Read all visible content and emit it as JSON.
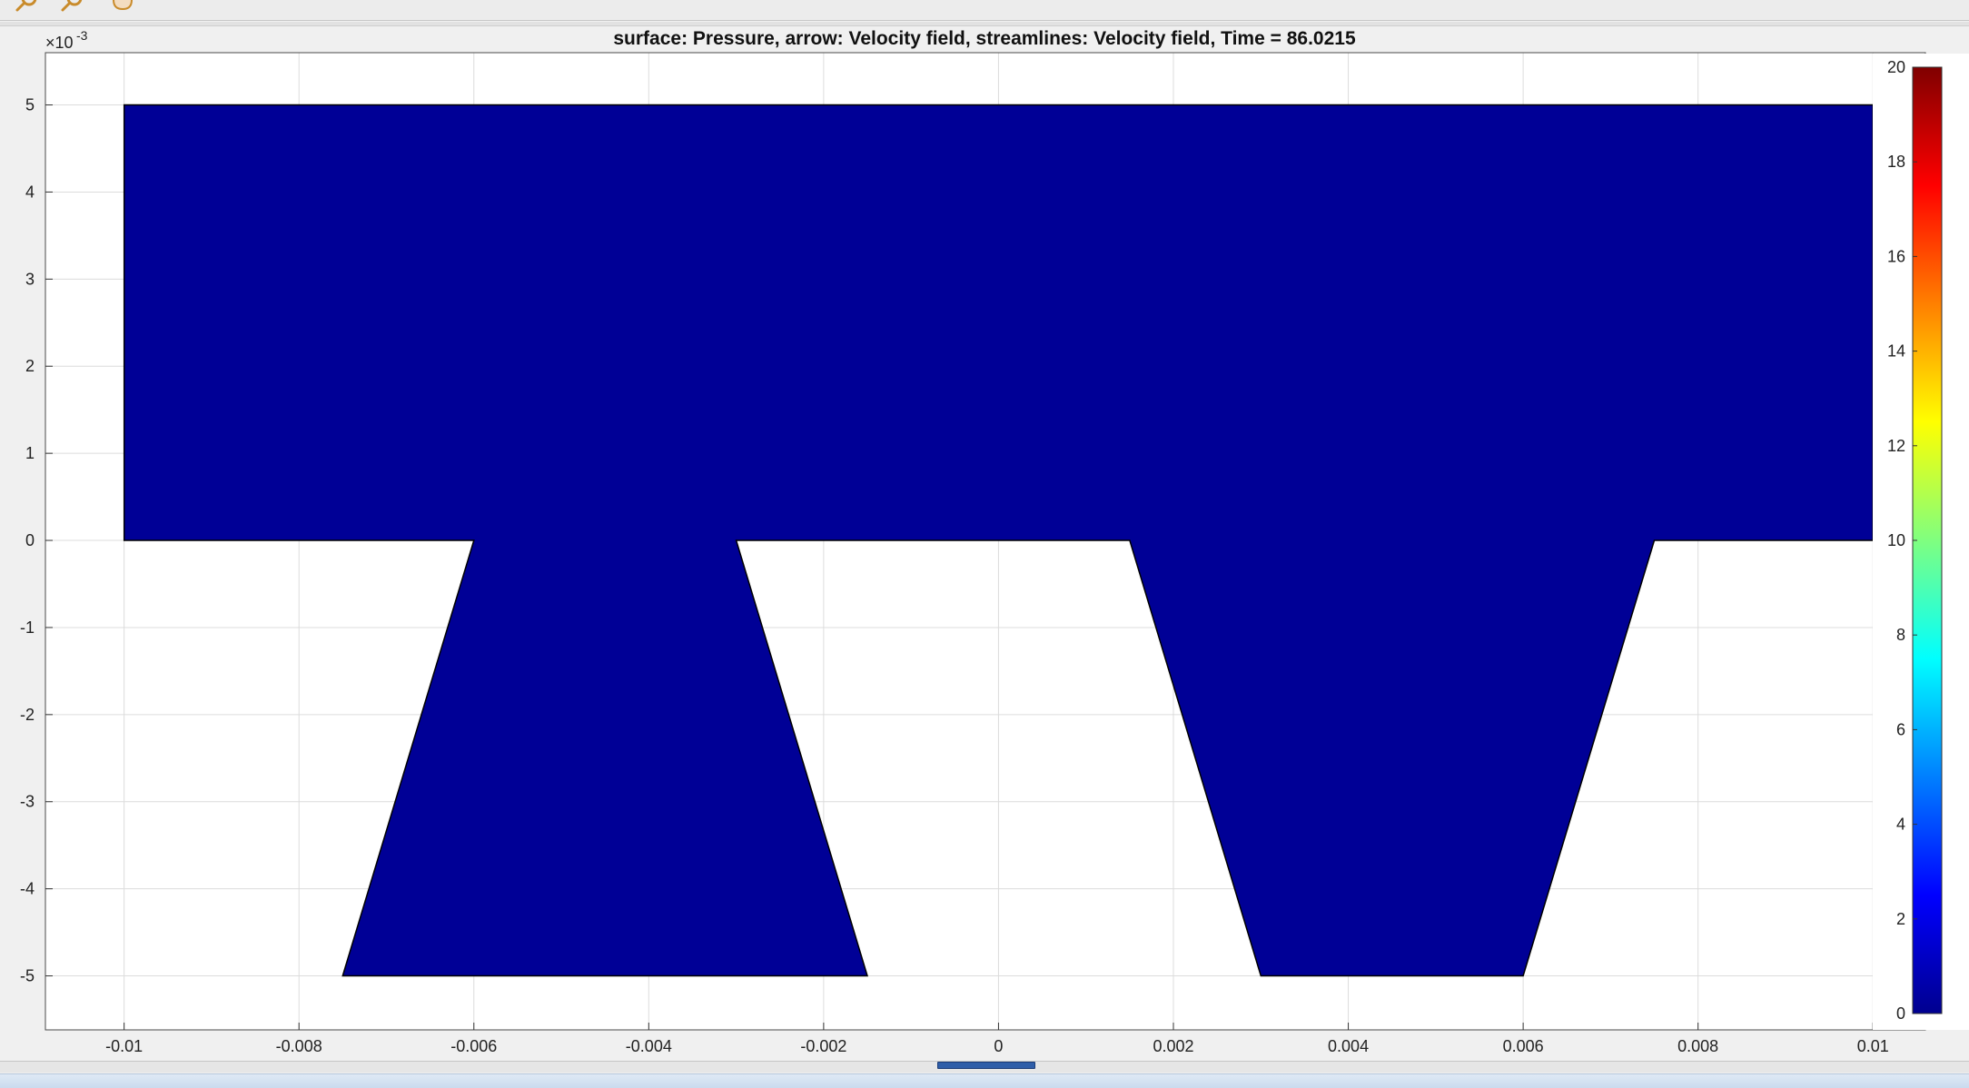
{
  "toolbar": {
    "buttons": [
      {
        "name": "zoom-in-icon"
      },
      {
        "name": "zoom-out-icon"
      },
      {
        "name": "pan-hand-icon"
      }
    ]
  },
  "colors": {
    "domain_fill": "#000096",
    "grid": "#dcdcdc",
    "axes_bg": "#ffffff",
    "figure_bg": "#f0f0f0"
  },
  "chart_data": {
    "type": "heatmap",
    "title": "surface: Pressure, arrow: Velocity field, streamlines: Velocity field, Time = 86.0215",
    "xlabel": "",
    "ylabel": "",
    "xlim": [
      -0.0109,
      0.0106
    ],
    "ylim": [
      -0.00562,
      0.0056
    ],
    "y_exponent_label": "×10",
    "y_exponent_power": "-3",
    "x_ticks": [
      {
        "value": -0.01,
        "label": "-0.01"
      },
      {
        "value": -0.008,
        "label": "-0.008"
      },
      {
        "value": -0.006,
        "label": "-0.006"
      },
      {
        "value": -0.004,
        "label": "-0.004"
      },
      {
        "value": -0.002,
        "label": "-0.002"
      },
      {
        "value": 0,
        "label": "0"
      },
      {
        "value": 0.002,
        "label": "0.002"
      },
      {
        "value": 0.004,
        "label": "0.004"
      },
      {
        "value": 0.006,
        "label": "0.006"
      },
      {
        "value": 0.008,
        "label": "0.008"
      },
      {
        "value": 0.01,
        "label": "0.01"
      }
    ],
    "y_ticks": [
      {
        "value": 0.005,
        "label": "5"
      },
      {
        "value": 0.004,
        "label": "4"
      },
      {
        "value": 0.003,
        "label": "3"
      },
      {
        "value": 0.002,
        "label": "2"
      },
      {
        "value": 0.001,
        "label": "1"
      },
      {
        "value": 0,
        "label": "0"
      },
      {
        "value": -0.001,
        "label": "-1"
      },
      {
        "value": -0.002,
        "label": "-2"
      },
      {
        "value": -0.003,
        "label": "-3"
      },
      {
        "value": -0.004,
        "label": "-4"
      },
      {
        "value": -0.005,
        "label": "-5"
      }
    ],
    "grid": true,
    "domain_outline": [
      [
        -0.01,
        0.005
      ],
      [
        0.01,
        0.005
      ],
      [
        0.01,
        0
      ],
      [
        0.0075,
        0
      ],
      [
        0.006,
        -0.005
      ],
      [
        0.003,
        -0.005
      ],
      [
        0.0015,
        0
      ],
      [
        -0.003,
        0
      ],
      [
        -0.0015,
        -0.005
      ],
      [
        -0.0075,
        -0.005
      ],
      [
        -0.006,
        0
      ],
      [
        -0.01,
        0
      ]
    ],
    "surface_value": 0,
    "colorbar": {
      "min": 0,
      "max": 20,
      "ticks": [
        {
          "value": 0,
          "label": "0"
        },
        {
          "value": 2,
          "label": "2"
        },
        {
          "value": 4,
          "label": "4"
        },
        {
          "value": 6,
          "label": "6"
        },
        {
          "value": 8,
          "label": "8"
        },
        {
          "value": 10,
          "label": "10"
        },
        {
          "value": 12,
          "label": "12"
        },
        {
          "value": 14,
          "label": "14"
        },
        {
          "value": 16,
          "label": "16"
        },
        {
          "value": 18,
          "label": "18"
        },
        {
          "value": 20,
          "label": "20"
        }
      ],
      "colormap": "jet"
    }
  }
}
